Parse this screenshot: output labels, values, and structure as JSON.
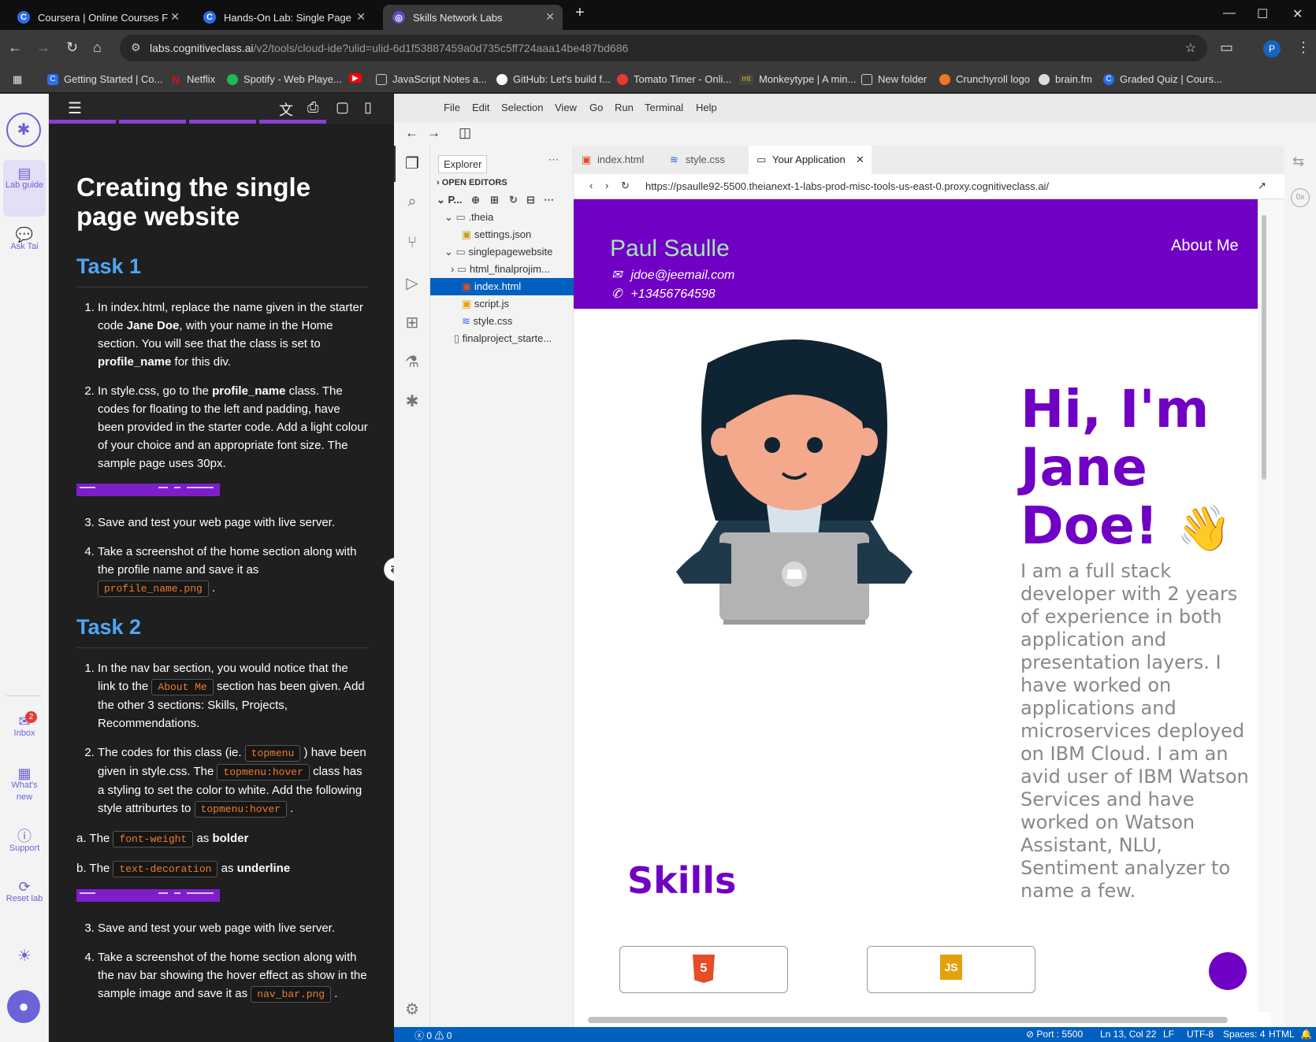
{
  "browser": {
    "tabs": [
      {
        "title": "Coursera | Online Courses From",
        "active": false
      },
      {
        "title": "Hands-On Lab: Single Page Por",
        "active": false
      },
      {
        "title": "Skills Network Labs",
        "active": true
      }
    ],
    "url_host": "labs.cognitiveclass.ai",
    "url_path": "/v2/tools/cloud-ide?ulid=ulid-6d1f53887459a0d735c5ff724aaa14be487bd686",
    "profile_initial": "P",
    "bookmarks": [
      "Getting Started | Co...",
      "Netflix",
      "Spotify - Web Playe...",
      "",
      "JavaScript Notes a...",
      "GitHub: Let's build f...",
      "Tomato Timer - Onli...",
      "Monkeytype | A min...",
      "New folder",
      "Crunchyroll logo",
      "brain.fm",
      "Graded Quiz | Cours..."
    ]
  },
  "rail": {
    "lab_guide": "Lab guide",
    "ask_tai": "Ask Tai",
    "inbox": "Inbox",
    "inbox_badge": "2",
    "whats_new": "What's new",
    "support": "Support",
    "reset_lab": "Reset lab"
  },
  "guide": {
    "title": "Creating the single page website",
    "task1": {
      "heading": "Task 1",
      "step1_a": "In index.html, replace the name given in the starter code ",
      "step1_b": "Jane Doe",
      "step1_c": ", with your name in the Home section. You will see that the class is set to ",
      "step1_d": "profile_name",
      "step1_e": " for this div.",
      "step2_a": "In style.css, go to the ",
      "step2_b": "profile_name",
      "step2_c": " class. The codes for floating to the left and padding, have been provided in the starter code. Add a light colour of your choice and an appropriate font size. The sample page uses 30px.",
      "step3": "Save and test your web page with live server.",
      "step4_a": "Take a screenshot of the home section along with the profile name and save it as",
      "step4_code": "profile_name.png",
      "step4_end": "."
    },
    "task2": {
      "heading": "Task 2",
      "step1_a": "In the nav bar section, you would notice that the link to the",
      "step1_code": "About Me",
      "step1_b": "section has been given. Add the other 3 sections: Skills, Projects, Recommendations.",
      "step2_a": "The codes for this class (ie.",
      "step2_code1": "topmenu",
      "step2_b": ") have been given in style.css. The",
      "step2_code2": "topmenu:hover",
      "step2_c": "class has a styling to set the color to white. Add the following style attriburtes to",
      "step2_code3": "topmenu:hover",
      "step2_d": ".",
      "a_label": "a. The",
      "a_code": "font-weight",
      "a_as": "as",
      "a_val": "bolder",
      "b_label": "b. The",
      "b_code": "text-decoration",
      "b_as": "as",
      "b_val": "underline",
      "step3": "Save and test your web page with live server.",
      "step4_a": "Take a screenshot of the home section along with the nav bar showing the hover effect as show in the sample image and save it as",
      "step4_code": "nav_bar.png",
      "step4_end": "."
    }
  },
  "ide": {
    "menus": [
      "File",
      "Edit",
      "Selection",
      "View",
      "Go",
      "Run",
      "Terminal",
      "Help"
    ],
    "tooltip": "Explorer",
    "explorer": {
      "open_editors": "OPEN EDITORS",
      "project": "P...",
      "items": [
        {
          "label": ".theia",
          "kind": "folder"
        },
        {
          "label": "settings.json",
          "kind": "json"
        },
        {
          "label": "singlepagewebsite",
          "kind": "folder"
        },
        {
          "label": "html_finalprojim...",
          "kind": "folder"
        },
        {
          "label": "index.html",
          "kind": "html"
        },
        {
          "label": "script.js",
          "kind": "js"
        },
        {
          "label": "style.css",
          "kind": "css"
        },
        {
          "label": "finalproject_starte...",
          "kind": "file"
        }
      ]
    },
    "editor_tabs": [
      "index.html",
      "style.css",
      "Your Application"
    ],
    "preview_url": "https://psaulle92-5500.theianext-1-labs-prod-misc-tools-us-east-0.proxy.cognitiveclass.ai/",
    "status": {
      "problems": "0",
      "warnings": "0",
      "port": "Port : 5500",
      "position": "Ln 13, Col 22",
      "eol": "LF",
      "encoding": "UTF-8",
      "spaces": "Spaces: 4",
      "language": "HTML"
    }
  },
  "site": {
    "name": "Paul Saulle",
    "email": "jdoe@jeemail.com",
    "phone": "+13456764598",
    "nav_about": "About Me",
    "greeting_line1": "Hi, I'm",
    "greeting_line2": "Jane",
    "greeting_line3": "Doe!",
    "wave": "👋",
    "bio": "I am a full stack developer with 2 years of experience in both application and presentation layers. I have worked on applications and microservices deployed on IBM Cloud. I am an avid user of IBM Watson Services and have worked on Watson Assistant, NLU, Sentiment analyzer to name a few.",
    "skills_heading": "Skills",
    "skill_cards": [
      "HTML",
      "JavaScript"
    ]
  },
  "colors": {
    "site_purple": "#7000c3",
    "name_green": "#a8e4b5",
    "guide_heading_blue": "#4fa7f5",
    "status_blue": "#0060c0"
  }
}
